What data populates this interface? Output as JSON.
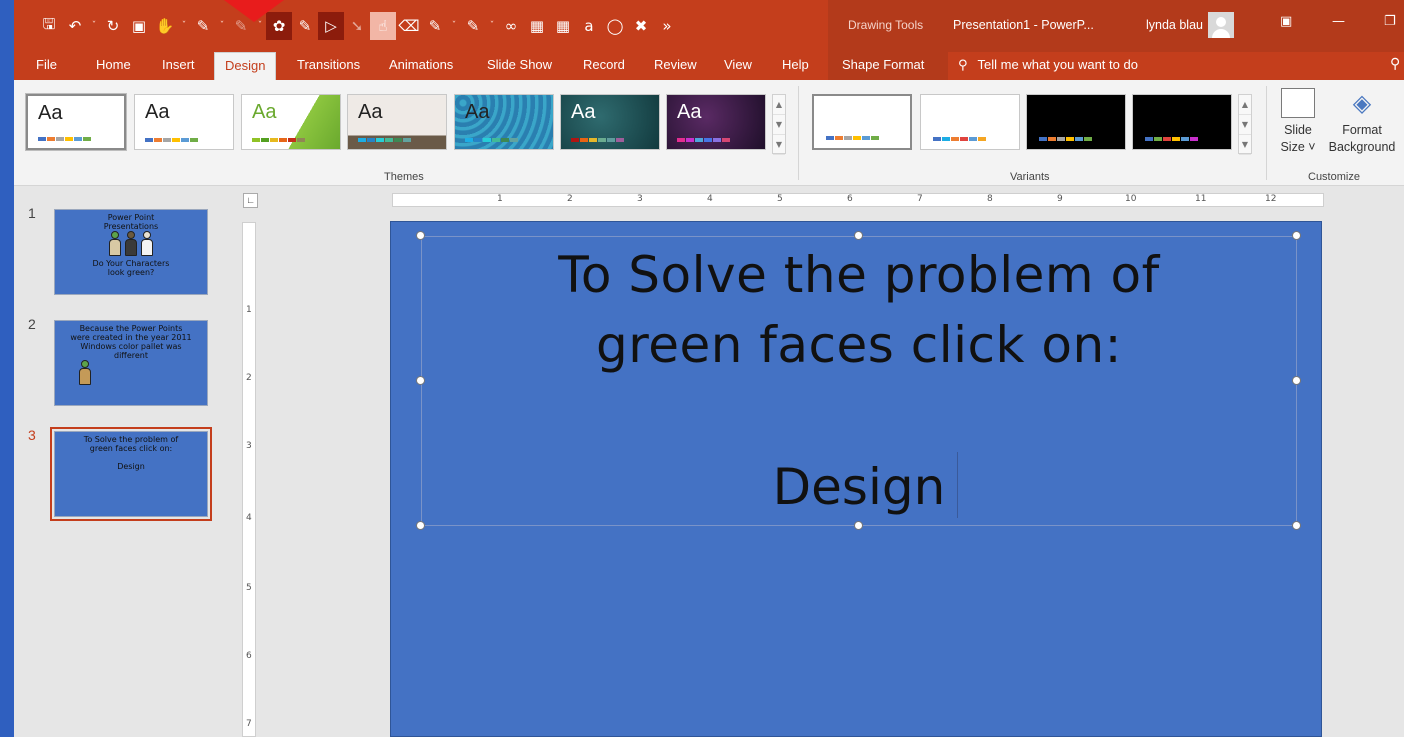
{
  "window": {
    "contextual_label": "Drawing Tools",
    "doc_title": "Presentation1  -  PowerP...",
    "user_name": "lynda blau"
  },
  "qat": {
    "icons": [
      "save-icon",
      "undo-icon",
      "redo-icon",
      "present-icon",
      "touch-mode-icon",
      "draw-icon",
      "pen-icon",
      "laser-icon",
      "replay-icon",
      "lasso-icon",
      "eraser-icon",
      "highlighter-icon",
      "ink-to-math-icon",
      "ink-to-shape-icon",
      "more-icon"
    ]
  },
  "tabs": {
    "file": "File",
    "home": "Home",
    "insert": "Insert",
    "design": "Design",
    "transitions": "Transitions",
    "animations": "Animations",
    "slideshow": "Slide Show",
    "record": "Record",
    "review": "Review",
    "view": "View",
    "help": "Help",
    "shape_format": "Shape Format",
    "tell_me": "Tell me what you want to do"
  },
  "ribbon": {
    "themes_label": "Themes",
    "variants_label": "Variants",
    "customize_label": "Customize",
    "theme_aa": "Aa",
    "slide_size_line1": "Slide",
    "slide_size_line2": "Size ˅",
    "format_bg_line1": "Format",
    "format_bg_line2": "Background"
  },
  "thumbnails": [
    {
      "num": "1",
      "line1": "Power Point",
      "line2": "Presentations",
      "line3": "Do Your Characters",
      "line4": "look green?"
    },
    {
      "num": "2",
      "line1": "Because the Power Points",
      "line2": "were created in the year 2011",
      "line3": "Windows color pallet was",
      "line4": "different"
    },
    {
      "num": "3",
      "line1": "To Solve the problem of",
      "line2": "green faces click on:",
      "line3": "Design"
    }
  ],
  "slide": {
    "line1": "To Solve the problem of",
    "line2": "green faces click on:",
    "line3": "Design"
  },
  "ruler": {
    "h": [
      "1",
      "2",
      "3",
      "4",
      "5",
      "6",
      "7",
      "8",
      "9",
      "10",
      "11",
      "12"
    ],
    "v": [
      "1",
      "2",
      "3",
      "4",
      "5",
      "6",
      "7"
    ]
  },
  "colors": {
    "accent": "#c43e1c",
    "slide_bg": "#4472c4"
  }
}
